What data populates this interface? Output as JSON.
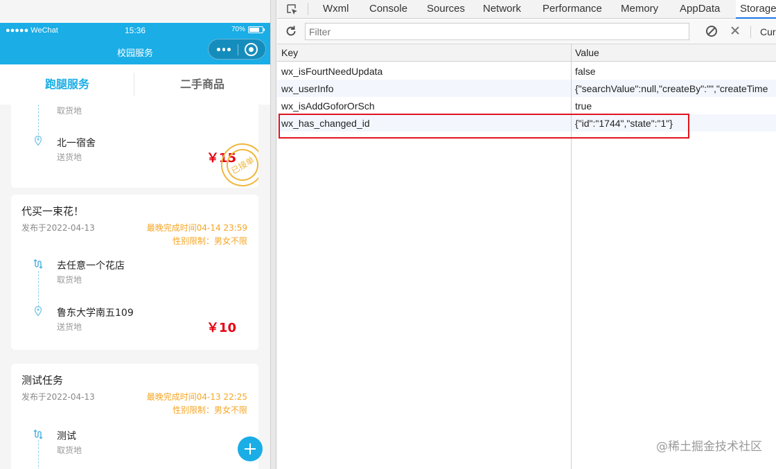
{
  "phone": {
    "status": {
      "carrier": "●●●●● WeChat",
      "wifi": "ᯤ",
      "time": "15:36",
      "battery": "70%"
    },
    "nav": {
      "title": "校园服务"
    },
    "tabs": [
      {
        "label": "跑腿服务",
        "active": true
      },
      {
        "label": "二手商品",
        "active": false
      }
    ],
    "orders": [
      {
        "pickup": {
          "name": "",
          "sub": "取货地"
        },
        "dropoff": {
          "name": "北一宿舍",
          "sub": "送货地"
        },
        "price": "￥15",
        "stamp": "已接单"
      },
      {
        "title": "代买一束花！",
        "published": "发布于2022-04-13",
        "deadline": "最晚完成时间04-14 23:59",
        "gender": "性别限制：男女不限",
        "pickup": {
          "name": "去任意一个花店",
          "sub": "取货地"
        },
        "dropoff": {
          "name": "鲁东大学南五109",
          "sub": "送货地"
        },
        "price": "￥10"
      },
      {
        "title": "测试任务",
        "published": "发布于2022-04-13",
        "deadline": "最晚完成时间04-13 22:25",
        "gender": "性别限制：男女不限",
        "pickup": {
          "name": "测试",
          "sub": "取货地"
        }
      }
    ]
  },
  "devtools": {
    "tabs": [
      "Wxml",
      "Console",
      "Sources",
      "Network",
      "Performance",
      "Memory",
      "AppData",
      "Storage"
    ],
    "active_tab": "Storage",
    "toolbar": {
      "filter_placeholder": "Filter",
      "cur_label": "Cur"
    },
    "table": {
      "headers": {
        "key": "Key",
        "value": "Value"
      },
      "rows": [
        {
          "key": "wx_isFourtNeedUpdata",
          "value": "false"
        },
        {
          "key": "wx_userInfo",
          "value": "{\"searchValue\":null,\"createBy\":\"\",\"createTime"
        },
        {
          "key": "wx_isAddGoforOrSch",
          "value": "true"
        },
        {
          "key": "wx_has_changed_id",
          "value": "{\"id\":\"1744\",\"state\":\"1\"}"
        }
      ]
    },
    "highlight_color": "#e0141e"
  },
  "watermark": "@稀土掘金技术社区",
  "colors": {
    "brand": "#1aade6",
    "price": "#e60012",
    "deadline": "#f5a623"
  }
}
